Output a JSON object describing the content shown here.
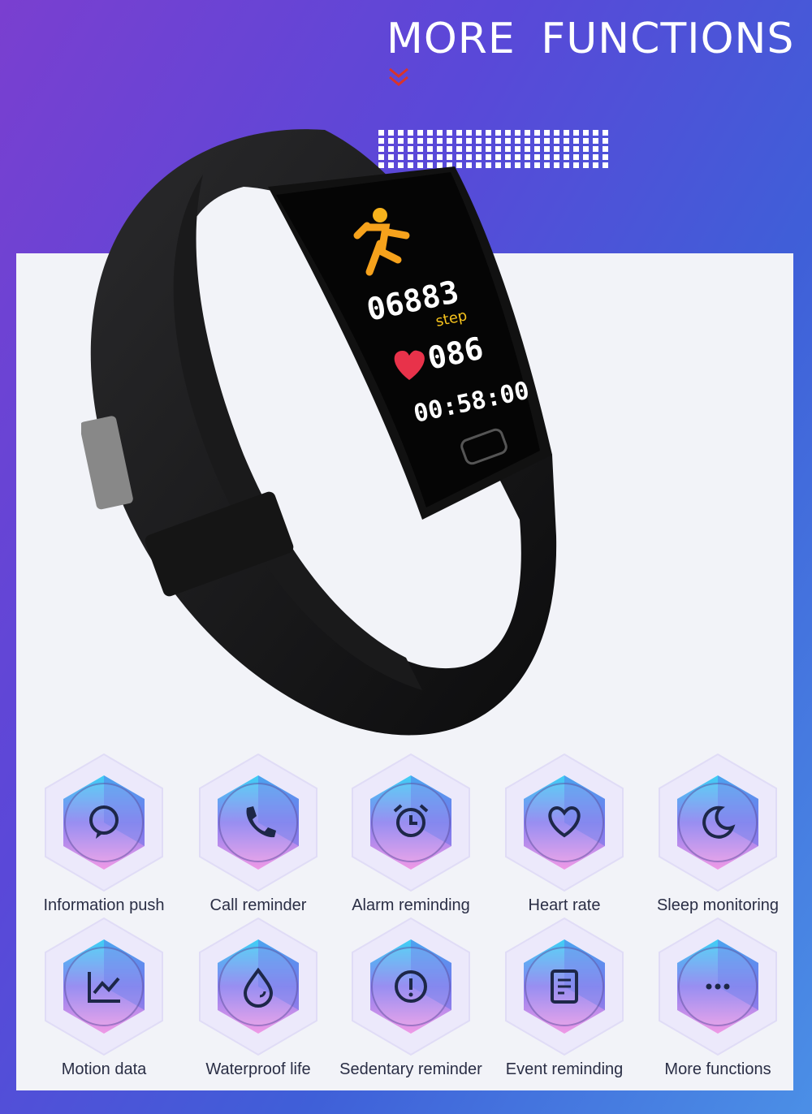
{
  "header": {
    "title": "MORE  FUNCTIONS"
  },
  "watch_screen": {
    "steps": "06883",
    "step_unit": "step",
    "heart_rate": "086",
    "time": "00:58:00"
  },
  "colors": {
    "accent_red": "#d9342b",
    "panel": "#f2f3f8",
    "icon_dark": "#1d2748"
  },
  "features": [
    {
      "label": "Information push",
      "icon": "chat-bubble-icon"
    },
    {
      "label": "Call reminder",
      "icon": "phone-icon"
    },
    {
      "label": "Alarm reminding",
      "icon": "alarm-clock-icon"
    },
    {
      "label": "Heart rate",
      "icon": "heart-icon"
    },
    {
      "label": "Sleep monitoring",
      "icon": "moon-icon"
    },
    {
      "label": "Motion data",
      "icon": "line-chart-icon"
    },
    {
      "label": "Waterproof life",
      "icon": "water-drop-icon"
    },
    {
      "label": "Sedentary reminder",
      "icon": "alert-circle-icon"
    },
    {
      "label": "Event reminding",
      "icon": "note-icon"
    },
    {
      "label": "More functions",
      "icon": "more-dots-icon"
    }
  ]
}
